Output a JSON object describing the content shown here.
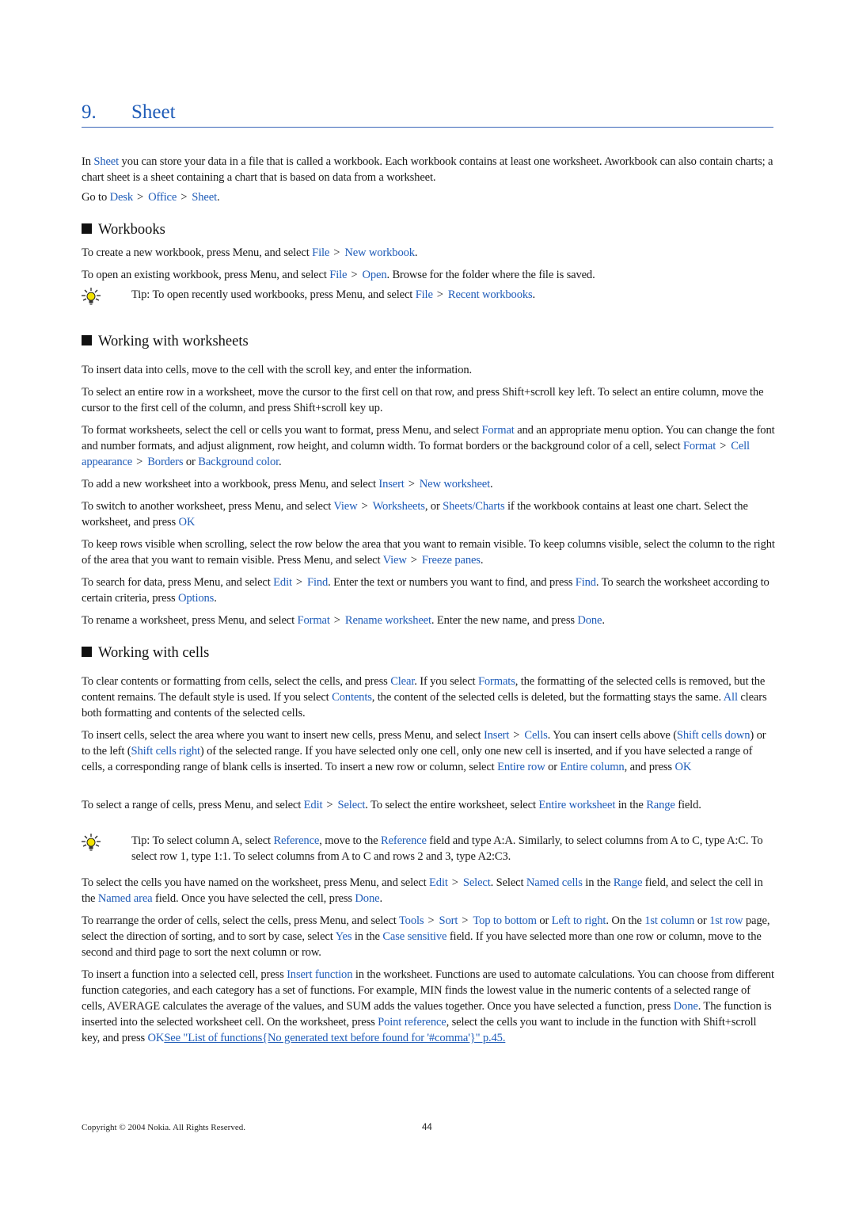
{
  "chapter": {
    "number": "9.",
    "title": "Sheet"
  },
  "intro": {
    "p1": [
      "In ",
      {
        "link": "Sheet"
      },
      " you can store your data in a file that is called a workbook. Each workbook contains at least one worksheet. Aworkbook can also contain charts; a chart sheet is a sheet containing a chart that is based on data from a worksheet."
    ],
    "p2": [
      "Go to ",
      {
        "link": "Desk"
      },
      {
        "sep": ">"
      },
      {
        "link": "Office"
      },
      {
        "sep": ">"
      },
      {
        "link": "Sheet"
      },
      "."
    ]
  },
  "sections": {
    "workbooks": {
      "title": "Workbooks",
      "p1": [
        "To create a new workbook, press Menu, and select ",
        {
          "link": "File"
        },
        {
          "sep": ">"
        },
        {
          "link": "New workbook"
        },
        "."
      ],
      "p2": [
        "To open an existing workbook, press Menu, and select ",
        {
          "link": "File"
        },
        {
          "sep": ">"
        },
        {
          "link": "Open"
        },
        ". Browse for the folder where the file is saved."
      ],
      "tip": [
        "Tip: To open recently used workbooks, press Menu, and select ",
        {
          "link": "File"
        },
        {
          "sep": ">"
        },
        {
          "link": "Recent workbooks"
        },
        "."
      ]
    },
    "worksheets": {
      "title": "Working with worksheets",
      "p1": [
        "To insert data into cells, move to the cell with the scroll key, and enter the information."
      ],
      "p2": [
        "To select an entire row in a worksheet, move the cursor to the first cell on that row, and press Shift+scroll key left. To select an entire column, move the cursor to the first cell of the column, and press Shift+scroll key up."
      ],
      "p3": [
        "To format worksheets, select the cell or cells you want to format, press Menu, and select ",
        {
          "link": "Format"
        },
        " and an appropriate menu option. You can change the font and number formats, and adjust alignment, row height, and column width. To format borders or the background color of a cell, select ",
        {
          "link": "Format"
        },
        {
          "sep": ">"
        },
        {
          "link": "Cell appearance"
        },
        {
          "sep": ">"
        },
        {
          "link": "Borders"
        },
        " or ",
        {
          "link": "Background color"
        },
        "."
      ],
      "p4": [
        "To add a new worksheet into a workbook, press Menu, and select ",
        {
          "link": "Insert"
        },
        {
          "sep": ">"
        },
        {
          "link": "New worksheet"
        },
        "."
      ],
      "p5": [
        "To switch to another worksheet, press Menu, and select ",
        {
          "link": "View"
        },
        {
          "sep": ">"
        },
        {
          "link": "Worksheets"
        },
        ", or ",
        {
          "link": "Sheets/Charts"
        },
        " if the workbook contains at least one chart. Select the worksheet, and press ",
        {
          "link": "OK"
        }
      ],
      "p6": [
        "To keep rows visible when scrolling, select the row below the area that you want to remain visible. To keep columns visible, select the column to the right of the area that you want to remain visible. Press Menu, and select ",
        {
          "link": "View"
        },
        {
          "sep": ">"
        },
        {
          "link": "Freeze panes"
        },
        "."
      ],
      "p7": [
        "To search for data, press Menu, and select ",
        {
          "link": "Edit"
        },
        {
          "sep": ">"
        },
        {
          "link": "Find"
        },
        ". Enter the text or numbers you want to find, and press ",
        {
          "link": "Find"
        },
        ". To search the worksheet according to certain criteria, press ",
        {
          "link": "Options"
        },
        "."
      ],
      "p8": [
        "To rename a worksheet, press Menu, and select ",
        {
          "link": "Format"
        },
        {
          "sep": ">"
        },
        {
          "link": "Rename worksheet"
        },
        ". Enter the new name, and press ",
        {
          "link": "Done"
        },
        "."
      ]
    },
    "cells": {
      "title": "Working with cells",
      "p1": [
        "To clear contents or formatting from cells, select the cells, and press ",
        {
          "link": "Clear"
        },
        ". If you select ",
        {
          "link": "Formats"
        },
        ", the formatting of the selected cells is removed, but the content remains. The default style is used. If you select ",
        {
          "link": "Contents"
        },
        ", the content of the selected cells is deleted, but the formatting stays the same. ",
        {
          "link": "All"
        },
        " clears both formatting and contents of the selected cells."
      ],
      "p2": [
        "To insert cells, select the area where you want to insert new cells, press Menu, and select ",
        {
          "link": "Insert"
        },
        {
          "sep": ">"
        },
        {
          "link": "Cells"
        },
        ". You can insert cells above (",
        {
          "link": "Shift cells down"
        },
        ") or to the left (",
        {
          "link": "Shift cells right"
        },
        ") of the selected range. If you have selected only one cell, only one new cell is inserted, and if you have selected a range of cells, a corresponding range of blank cells is inserted. To insert a new row or column, select ",
        {
          "link": "Entire row"
        },
        " or ",
        {
          "link": "Entire column"
        },
        ", and press ",
        {
          "link": "OK"
        }
      ],
      "p3": [
        "To select a range of cells, press Menu, and select ",
        {
          "link": "Edit"
        },
        {
          "sep": ">"
        },
        {
          "link": "Select"
        },
        ". To select the entire worksheet, select ",
        {
          "link": "Entire worksheet"
        },
        " in the ",
        {
          "link": "Range"
        },
        " field."
      ],
      "tip": [
        "Tip:  To select column A, select ",
        {
          "link": "Reference"
        },
        ", move to the ",
        {
          "link": "Reference"
        },
        " field and type A:A. Similarly, to select columns from A to C, type A:C. To select row 1, type 1:1. To select columns from A to C and rows 2 and 3, type A2:C3."
      ],
      "p4": [
        "To select the cells you have named on the worksheet, press Menu, and select ",
        {
          "link": "Edit"
        },
        {
          "sep": ">"
        },
        {
          "link": "Select"
        },
        ". Select ",
        {
          "link": "Named cells"
        },
        " in the ",
        {
          "link": "Range"
        },
        " field, and select the cell in the ",
        {
          "link": "Named area"
        },
        " field. Once you have selected the cell, press ",
        {
          "link": "Done"
        },
        "."
      ],
      "p5": [
        "To rearrange the order of cells, select the cells, press Menu, and select ",
        {
          "link": "Tools"
        },
        {
          "sep": ">"
        },
        {
          "link": "Sort"
        },
        {
          "sep": ">"
        },
        {
          "link": "Top to bottom"
        },
        " or ",
        {
          "link": "Left to right"
        },
        ". On the ",
        {
          "link": "1st column"
        },
        " or ",
        {
          "link": "1st row"
        },
        " page, select the direction of sorting, and to sort by case, select ",
        {
          "link": "Yes"
        },
        " in the ",
        {
          "link": "Case sensitive"
        },
        " field. If you have selected more than one row or column, move to the second and third page to sort the next column or row."
      ],
      "p6": [
        "To insert a function into a selected cell, press ",
        {
          "link": "Insert function"
        },
        " in the worksheet. Functions are used to automate calculations. You can choose from different function categories, and each category has a set of functions. For example, MIN finds the lowest value in the numeric contents of a selected range of cells, AVERAGE calculates the average of the values, and SUM adds the values together. Once you have selected a function, press ",
        {
          "link": "Done"
        },
        ". The function is inserted into the selected worksheet cell. On the worksheet, press ",
        {
          "link": "Point reference"
        },
        ", select the cells you want to include in the function with Shift+scroll key, and press ",
        {
          "link": "OK"
        },
        {
          "ulink": "See \"List of functions{No generated text before found for '#comma'}\" p.45."
        }
      ]
    }
  },
  "footer": {
    "copyright": "Copyright © 2004 Nokia. All Rights Reserved.",
    "page_number": "44"
  },
  "colors": {
    "link": "#1f5cb8",
    "rule": "#3a66b8",
    "text": "#1a1a1a"
  },
  "icons": {
    "tip": "lightbulb-icon",
    "section_marker": "black-square"
  }
}
